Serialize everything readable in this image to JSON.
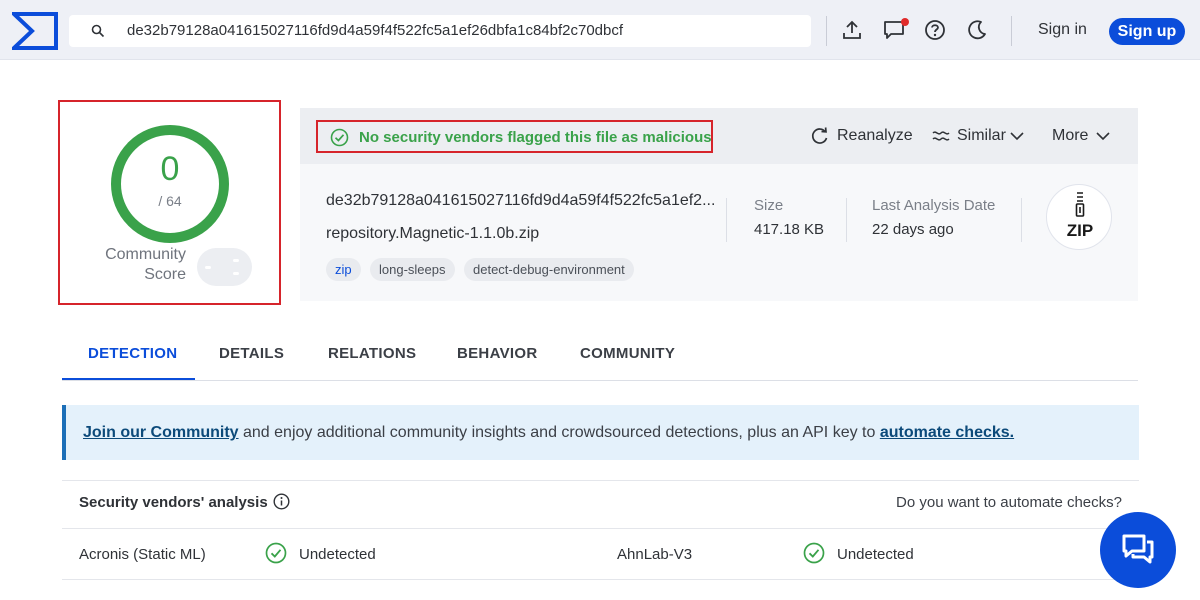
{
  "topbar": {
    "search_value": "de32b79128a041615027116fd9d4a59f4f522fc5a1ef26dbfa1c84bf2c70dbcf",
    "sign_in": "Sign in",
    "sign_up": "Sign up"
  },
  "score": {
    "value": "0",
    "total": "/ 64",
    "community_label_1": "Community",
    "community_label_2": "Score"
  },
  "summary": {
    "status": "No security vendors flagged this file as malicious",
    "actions": {
      "reanalyze": "Reanalyze",
      "similar": "Similar",
      "more": "More"
    },
    "hash": "de32b79128a041615027116fd9d4a59f4f522fc5a1ef2...",
    "filename": "repository.Magnetic-1.1.0b.zip",
    "tags": [
      "zip",
      "long-sleeps",
      "detect-debug-environment"
    ],
    "size_label": "Size",
    "size_value": "417.18 KB",
    "date_label": "Last Analysis Date",
    "date_value": "22 days ago",
    "file_type_icon": "zip-file-icon",
    "file_type_label": "ZIP"
  },
  "tabs": [
    "DETECTION",
    "DETAILS",
    "RELATIONS",
    "BEHAVIOR",
    "COMMUNITY"
  ],
  "banner": {
    "link1": "Join our Community",
    "middle": " and enjoy additional community insights and crowdsourced detections, plus an API key to ",
    "link2": "automate checks."
  },
  "vendors": {
    "heading": "Security vendors' analysis",
    "question": "Do you want to automate checks?",
    "rows": [
      {
        "vendor1": "Acronis (Static ML)",
        "status1": "Undetected",
        "vendor2": "AhnLab-V3",
        "status2": "Undetected"
      }
    ]
  },
  "colors": {
    "accent": "#0b4dda",
    "clean": "#3aa24a",
    "highlight_border": "#d6242b"
  }
}
